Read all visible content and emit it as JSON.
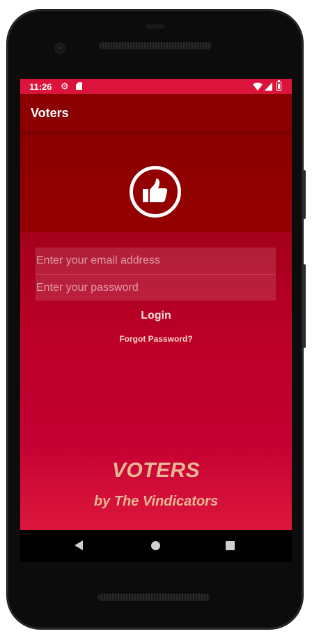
{
  "status_bar": {
    "time": "11:26",
    "icons": [
      "gear-icon",
      "sd-card-icon",
      "wifi-icon",
      "signal-icon",
      "battery-icon"
    ]
  },
  "app_bar": {
    "title": "Voters"
  },
  "logo": {
    "icon": "thumbs-up-icon"
  },
  "login_form": {
    "email_placeholder": "Enter your email address",
    "email_value": "",
    "password_placeholder": "Enter your password",
    "password_value": "",
    "login_label": "Login",
    "forgot_label": "Forgot Password?"
  },
  "branding": {
    "title": "VOTERS",
    "subtitle": "by The Vindicators"
  },
  "nav_bar": {
    "icons": [
      "back-icon",
      "home-icon",
      "recents-icon"
    ]
  },
  "colors": {
    "status_bar": "#dc143c",
    "app_bar": "#8b0000",
    "accent_text": "#e8b896"
  }
}
